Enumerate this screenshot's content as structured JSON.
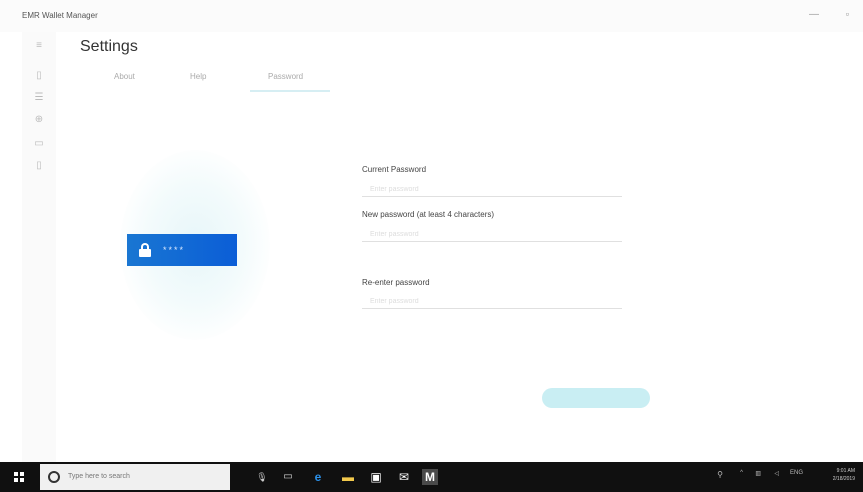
{
  "window": {
    "title": "EMR Wallet Manager",
    "minimize_symbol": "—",
    "maximize_symbol": "▫"
  },
  "rail": {
    "icons": [
      "hamburger-menu-icon",
      "wallet-icon",
      "list-icon",
      "plus-icon",
      "device-icon",
      "document-icon"
    ]
  },
  "settings": {
    "title": "Settings",
    "tabs": [
      "About",
      "Help",
      "Password"
    ],
    "active_tab": "Password"
  },
  "illustration": {
    "masked_text": "****"
  },
  "form": {
    "current_label": "Current Password",
    "current_placeholder": "Enter password",
    "new_label": "New password (at least 4 characters)",
    "new_placeholder": "Enter password",
    "reenter_label": "Re-enter password",
    "reenter_placeholder": "Enter password"
  },
  "taskbar": {
    "search_placeholder": "Type here to search",
    "time": "9:01 AM",
    "date": "2/18/2019",
    "language": "ENG"
  },
  "colors": {
    "accent": "#0b5ed7",
    "submit_button": "#c9eef3"
  }
}
